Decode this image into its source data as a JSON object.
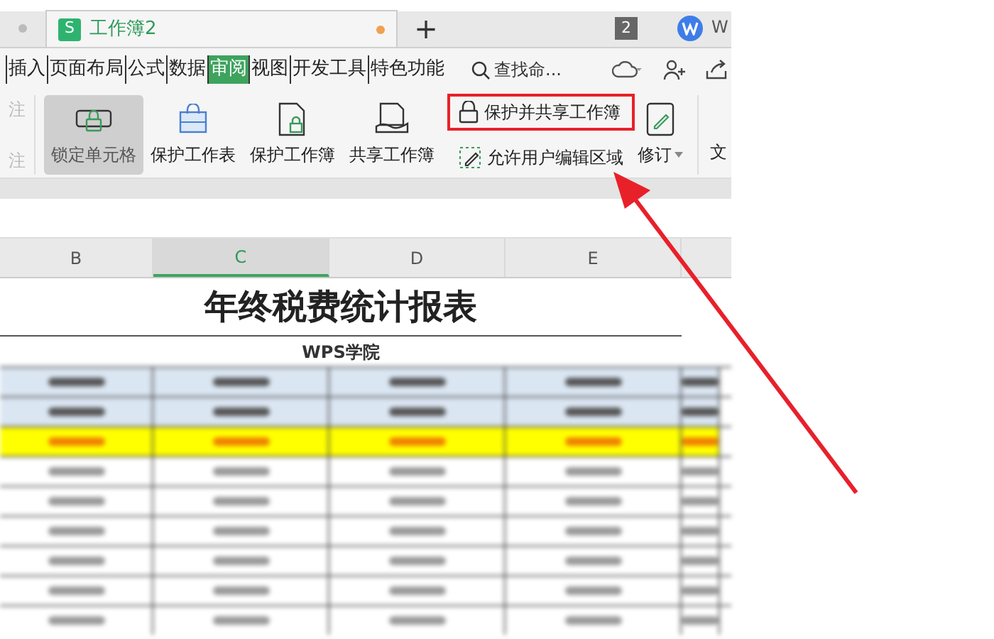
{
  "tabs": [
    {
      "title": "工作簿2",
      "selected": true,
      "unsaved": true
    }
  ],
  "app_letter": "S",
  "new_tab_symbol": "+",
  "tab_count": "2",
  "account_initial": "W",
  "menu": [
    {
      "label": "插入",
      "selected": false
    },
    {
      "label": "页面布局",
      "selected": false
    },
    {
      "label": "公式",
      "selected": false
    },
    {
      "label": "数据",
      "selected": false
    },
    {
      "label": "审阅",
      "selected": true
    },
    {
      "label": "视图",
      "selected": false
    },
    {
      "label": "开发工具",
      "selected": false
    },
    {
      "label": "特色功能",
      "selected": false
    }
  ],
  "search_label": "查找命...",
  "ribbon": {
    "faded": [
      {
        "label": "注",
        "disabled": true
      },
      {
        "label": "注",
        "disabled": true
      }
    ],
    "large_buttons": [
      {
        "label": "锁定单元格",
        "kind": "lock-cell",
        "pressed": true
      },
      {
        "label": "保护工作表",
        "kind": "sheet",
        "pressed": false
      },
      {
        "label": "保护工作簿",
        "kind": "book",
        "pressed": false
      },
      {
        "label": "共享工作簿",
        "kind": "share",
        "pressed": false
      }
    ],
    "small_buttons": [
      {
        "label": "保护并共享工作簿",
        "kind": "lock",
        "highlighted": true
      },
      {
        "label": "允许用户编辑区域",
        "kind": "range",
        "highlighted": false
      }
    ],
    "revise": "修订",
    "cut_label": "文"
  },
  "sheet": {
    "columns": [
      {
        "label": "B",
        "selected": false
      },
      {
        "label": "C",
        "selected": true
      },
      {
        "label": "D",
        "selected": false
      },
      {
        "label": "E",
        "selected": false
      }
    ],
    "title": "年终税费统计报表",
    "subtitle": "WPS学院"
  }
}
